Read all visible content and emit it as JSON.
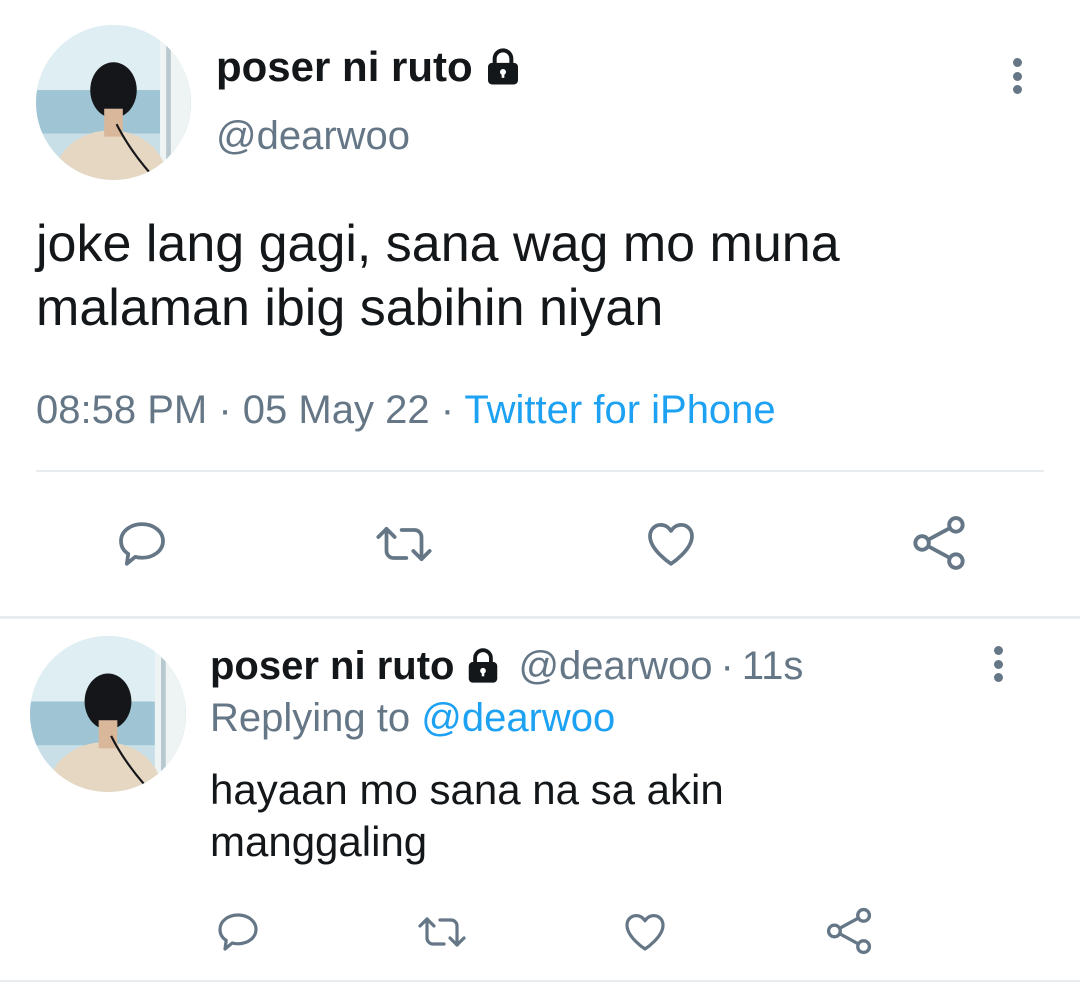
{
  "main_tweet": {
    "display_name": "poser ni ruto",
    "handle": "@dearwoo",
    "text_line1": "joke lang gagi, sana wag mo muna",
    "text_line2": "malaman ibig sabihin niyan",
    "time": "08:58 PM",
    "sep1": "·",
    "date": "05 May 22",
    "sep2": "·",
    "source": "Twitter for iPhone"
  },
  "reply_tweet": {
    "display_name": "poser ni ruto",
    "handle": "@dearwoo",
    "sep": "·",
    "age": "11s",
    "replying_to_label": "Replying to",
    "replying_to_handle": "@dearwoo",
    "text_line1": "hayaan mo sana na sa akin",
    "text_line2": "manggaling"
  },
  "icons": {
    "reply": "reply-icon",
    "retweet": "retweet-icon",
    "like": "heart-icon",
    "share": "share-icon",
    "more": "more-vertical-icon",
    "lock": "lock-icon"
  },
  "colors": {
    "text": "#14171a",
    "muted": "#657786",
    "link": "#1da1f2",
    "divider": "#e6ecf0"
  }
}
